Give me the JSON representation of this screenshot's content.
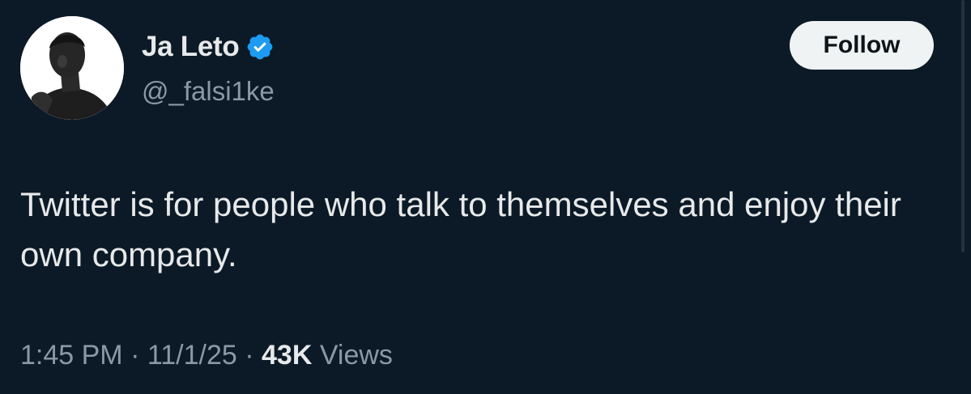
{
  "tweet": {
    "display_name": "Ja Leto",
    "verified_icon": "verified-badge-icon",
    "handle": "@_falsi1ke",
    "follow_label": "Follow",
    "text": "Twitter is for people who talk to themselves and enjoy their own company.",
    "time": "1:45 PM",
    "date": "11/1/25",
    "separator": "·",
    "views_count": "43K",
    "views_label": "Views"
  },
  "colors": {
    "background": "#0c1a27",
    "primary_text": "#e7e9ea",
    "secondary_text": "#8b98a5",
    "verified_blue": "#1d9bf0",
    "follow_button_bg": "#eff3f4",
    "follow_button_text": "#0f1419"
  }
}
